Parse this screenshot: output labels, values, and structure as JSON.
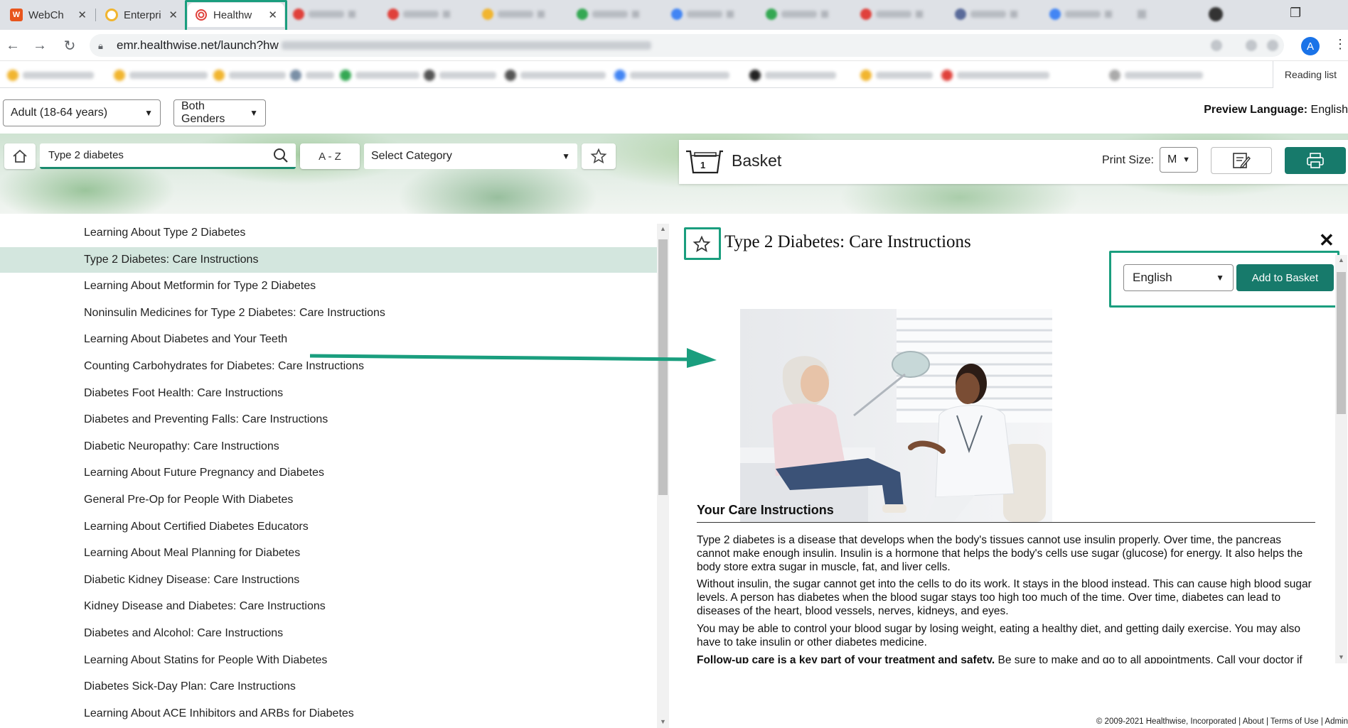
{
  "browser": {
    "tabs": [
      {
        "title": "WebCh",
        "icon": "W",
        "color": "#e8551d"
      },
      {
        "title": "Enterpri",
        "icon": "",
        "color": "#f1b52f"
      },
      {
        "title": "Healthw",
        "icon": "",
        "color": "#e0413b"
      }
    ],
    "url": "emr.healthwise.net/launch?hw",
    "avatar_letter": "A",
    "reading_list": "Reading list"
  },
  "filters": {
    "age": "Adult (18-64 years)",
    "gender": "Both Genders",
    "preview_language_label": "Preview Language:",
    "preview_language_value": "English"
  },
  "toolbar": {
    "search_value": "Type 2 diabetes",
    "az_label": "A - Z",
    "category_placeholder": "Select Category",
    "basket_title": "Basket",
    "basket_count": "1",
    "print_size_label": "Print Size:",
    "print_size_value": "M"
  },
  "results": [
    "Learning About Type 2 Diabetes",
    "Type 2 Diabetes: Care Instructions",
    "Learning About Metformin for Type 2 Diabetes",
    "Noninsulin Medicines for Type 2 Diabetes: Care Instructions",
    "Learning About Diabetes and Your Teeth",
    "Counting Carbohydrates for Diabetes: Care Instructions",
    "Diabetes Foot Health: Care Instructions",
    "Diabetes and Preventing Falls: Care Instructions",
    "Diabetic Neuropathy: Care Instructions",
    "Learning About Future Pregnancy and Diabetes",
    "General Pre-Op for People With Diabetes",
    "Learning About Certified Diabetes Educators",
    "Learning About Meal Planning for Diabetes",
    "Diabetic Kidney Disease: Care Instructions",
    "Kidney Disease and Diabetes: Care Instructions",
    "Diabetes and Alcohol: Care Instructions",
    "Learning About Statins for People With Diabetes",
    "Diabetes Sick-Day Plan: Care Instructions",
    "Learning About ACE Inhibitors and ARBs for Diabetes"
  ],
  "selected_index": 1,
  "detail": {
    "title": "Type 2 Diabetes: Care Instructions",
    "language": "English",
    "add_button": "Add to Basket",
    "section_title": "Your Care Instructions",
    "paragraphs": [
      "Type 2 diabetes is a disease that develops when the body's tissues cannot use insulin properly. Over time, the pancreas cannot make enough insulin. Insulin is a hormone that helps the body's cells use sugar (glucose) for energy. It also helps the body store extra sugar in muscle, fat, and liver cells.",
      "Without insulin, the sugar cannot get into the cells to do its work. It stays in the blood instead. This can cause high blood sugar levels. A person has diabetes when the blood sugar stays too high too much of the time. Over time, diabetes can lead to diseases of the heart, blood vessels, nerves, kidneys, and eyes.",
      "You may be able to control your blood sugar by losing weight, eating a healthy diet, and getting daily exercise. You may also have to take insulin or other diabetes medicine."
    ],
    "followup_bold": "Follow-up care is a key part of your treatment and safety.",
    "followup_rest": " Be sure to make and go to all appointments. Call your doctor if"
  },
  "footer": "© 2009-2021 Healthwise, Incorporated | About | Terms of Use | Admin",
  "colors": {
    "accent": "#177a6b",
    "highlight": "#1a9e7e",
    "selected_row": "#d3e6de"
  }
}
